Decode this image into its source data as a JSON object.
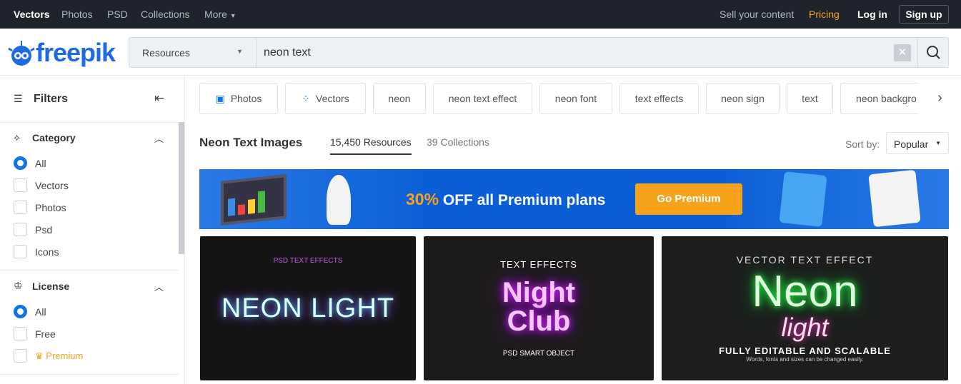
{
  "topnav": {
    "items": [
      "Vectors",
      "Photos",
      "PSD",
      "Collections",
      "More"
    ],
    "sell": "Sell your content",
    "pricing": "Pricing",
    "login": "Log in",
    "signup": "Sign up"
  },
  "logo": "freepik",
  "search": {
    "type": "Resources",
    "query": "neon text"
  },
  "filters": {
    "title": "Filters",
    "category": {
      "title": "Category",
      "options": [
        "All",
        "Vectors",
        "Photos",
        "Psd",
        "Icons"
      ],
      "selected": "All"
    },
    "license": {
      "title": "License",
      "options": [
        "All",
        "Free",
        "Premium"
      ],
      "selected": "All"
    }
  },
  "tags": [
    "Photos",
    "Vectors",
    "neon",
    "neon text effect",
    "neon font",
    "text effects",
    "neon sign",
    "text",
    "neon backgro"
  ],
  "results": {
    "title": "Neon Text Images",
    "tab_resources": "15,450 Resources",
    "tab_collections": "39 Collections",
    "sort_label": "Sort by:",
    "sort_value": "Popular"
  },
  "banner": {
    "discount": "30%",
    "text": "OFF all Premium plans",
    "button": "Go Premium"
  },
  "cards": [
    {
      "top": "PSD TEXT EFFECTS",
      "main": "NEON LIGHT"
    },
    {
      "top": "TEXT EFFECTS",
      "main": "Night Club",
      "bottom": "PSD SMART OBJECT"
    },
    {
      "top": "VECTOR TEXT EFFECT",
      "main": "Neon",
      "sub": "light",
      "bottom": "FULLY EDITABLE AND SCALABLE",
      "small": "Words, fonts and sizes can be changed easily."
    }
  ],
  "colors": {
    "brand": "#1273eb",
    "topbar": "#1f242b",
    "pricing": "#f5a623",
    "banner": "#0b5fd6",
    "cta": "#f7a21b"
  }
}
